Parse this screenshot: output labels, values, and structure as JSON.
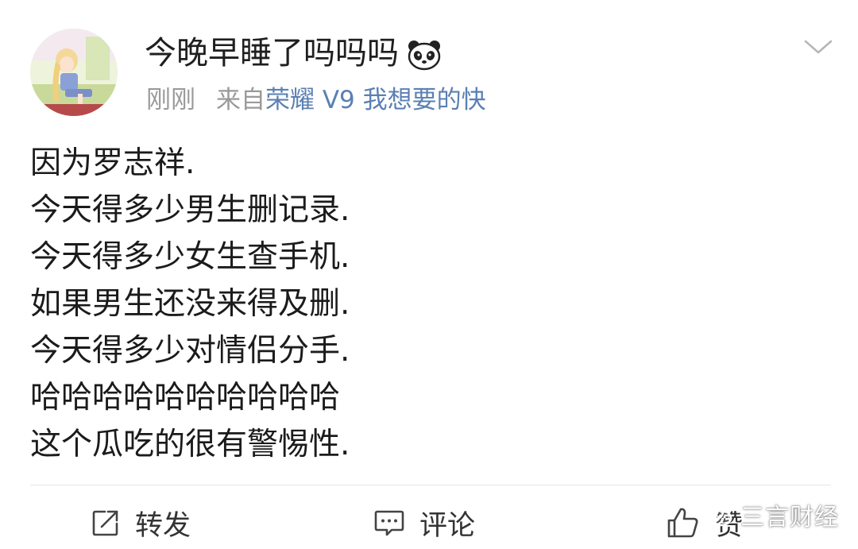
{
  "post": {
    "username": "今晚早睡了吗吗吗",
    "time": "刚刚",
    "source_prefix": "来自",
    "source_device": "荣耀 V9 我想要的快",
    "lines": [
      "因为罗志祥.",
      "今天得多少男生删记录.",
      "今天得多少女生查手机.",
      "如果男生还没来得及删.",
      "今天得多少对情侣分手.",
      "哈哈哈哈哈哈哈哈哈哈",
      "这个瓜吃的很有警惕性."
    ]
  },
  "actions": {
    "repost_label": "转发",
    "comment_label": "评论",
    "like_label": "赞"
  },
  "watermark": {
    "text": "三言财经"
  },
  "icons": {
    "username_emoji": "panda-icon",
    "more": "chevron-down-icon",
    "repost": "repost-icon",
    "comment": "comment-icon",
    "like": "thumbs-up-icon",
    "watermark": "wechat-icon"
  },
  "colors": {
    "source_link": "#5b80b3",
    "meta_gray": "#9a9a9a",
    "text": "#1b1b1b"
  }
}
